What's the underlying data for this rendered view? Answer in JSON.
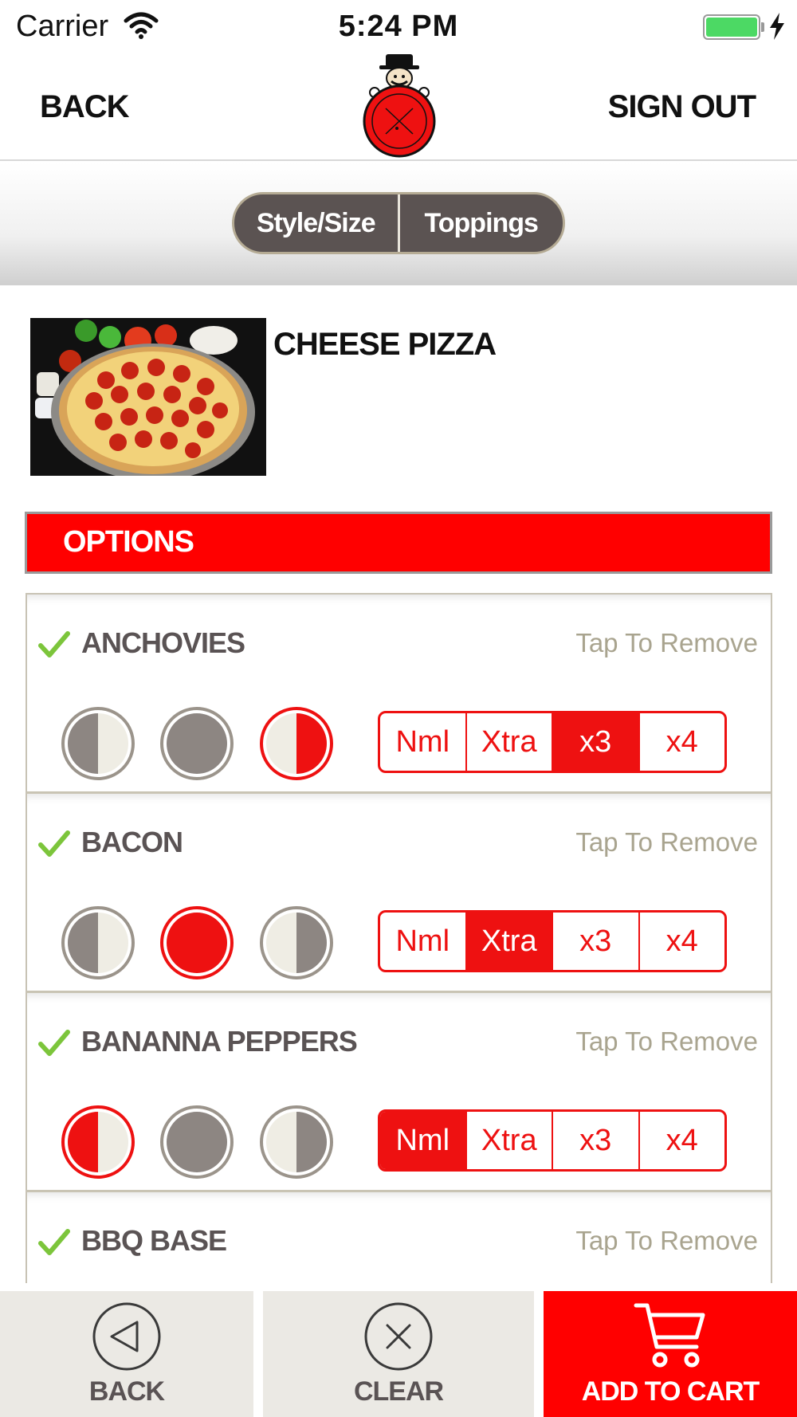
{
  "status_bar": {
    "carrier": "Carrier",
    "time": "5:24 PM"
  },
  "nav": {
    "back_label": "BACK",
    "signout_label": "SIGN OUT",
    "logo_icon": "dinos-pizza-logo"
  },
  "segments": [
    {
      "label": "Style/Size"
    },
    {
      "label": "Toppings"
    }
  ],
  "product": {
    "title": "CHEESE PIZZA",
    "image_icon": "pepperoni-pizza-photo"
  },
  "options": {
    "header": "OPTIONS"
  },
  "toppings": [
    {
      "name": "ANCHOVIES",
      "remove_label": "Tap To Remove",
      "placement_selected": "right-half",
      "amount_options": [
        "Nml",
        "Xtra",
        "x3",
        "x4"
      ],
      "amount_selected": "x3"
    },
    {
      "name": "BACON",
      "remove_label": "Tap To Remove",
      "placement_selected": "whole",
      "amount_options": [
        "Nml",
        "Xtra",
        "x3",
        "x4"
      ],
      "amount_selected": "Xtra"
    },
    {
      "name": "BANANNA PEPPERS",
      "remove_label": "Tap To Remove",
      "placement_selected": "left-half",
      "amount_options": [
        "Nml",
        "Xtra",
        "x3",
        "x4"
      ],
      "amount_selected": "Nml"
    },
    {
      "name": "BBQ BASE",
      "remove_label": "Tap To Remove"
    }
  ],
  "toolbar": {
    "back_label": "BACK",
    "clear_label": "CLEAR",
    "cart_label": "ADD TO CART"
  },
  "colors": {
    "accent_red": "#ff0000",
    "segment_bg": "#5b5352",
    "muted_text": "#a9a48f",
    "check_green": "#7cc53b"
  }
}
